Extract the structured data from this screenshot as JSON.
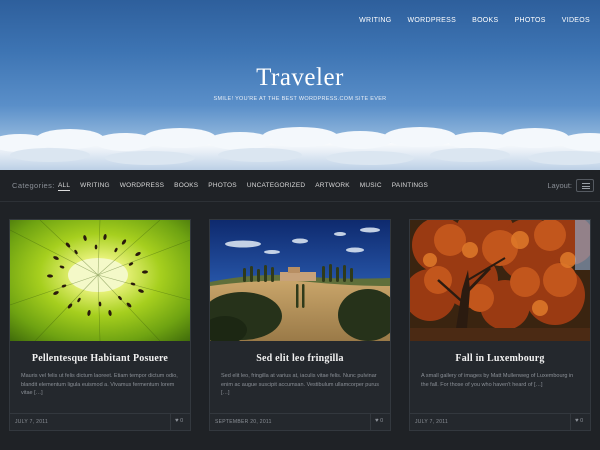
{
  "nav": [
    "WRITING",
    "WORDPRESS",
    "BOOKS",
    "PHOTOS",
    "VIDEOS"
  ],
  "site": {
    "title": "Traveler",
    "tagline": "SMILE! YOU'RE AT THE BEST WORDPRESS.COM SITE EVER"
  },
  "filter": {
    "label": "Categories:",
    "categories": [
      "ALL",
      "WRITING",
      "WORDPRESS",
      "BOOKS",
      "PHOTOS",
      "UNCATEGORIZED",
      "ARTWORK",
      "MUSIC",
      "PAINTINGS"
    ],
    "active": "ALL",
    "layout_label": "Layout:"
  },
  "posts": [
    {
      "title": "Pellentesque Habitant Posuere",
      "excerpt": "Mauris vel felis ut felis dictum laoreet. Etiam tempor dictum odio, blandit elementum ligula euismod a. Vivamus fermentum lorem vitae […]",
      "date": "JULY 7, 2011",
      "likes": "0",
      "image": "kiwi-slice"
    },
    {
      "title": "Sed elit leo fringilla",
      "excerpt": "Sed elit leo, fringilla at varius at, iaculis vitae felis. Nunc pulvinar enim ac augue suscipit accumsan. Vestibulum ullamcorper purus […]",
      "date": "SEPTEMBER 20, 2011",
      "likes": "0",
      "image": "tuscan-hillside"
    },
    {
      "title": "Fall in Luxembourg",
      "excerpt": "A small gallery of images by Matt Mullenweg of Luxembourg in the fall. For those of you who haven't heard of […]",
      "date": "JULY 7, 2011",
      "likes": "0",
      "image": "autumn-tree"
    }
  ],
  "colors": {
    "background": "#1f2226",
    "card": "#24282d",
    "sky": "#3d74b3"
  }
}
